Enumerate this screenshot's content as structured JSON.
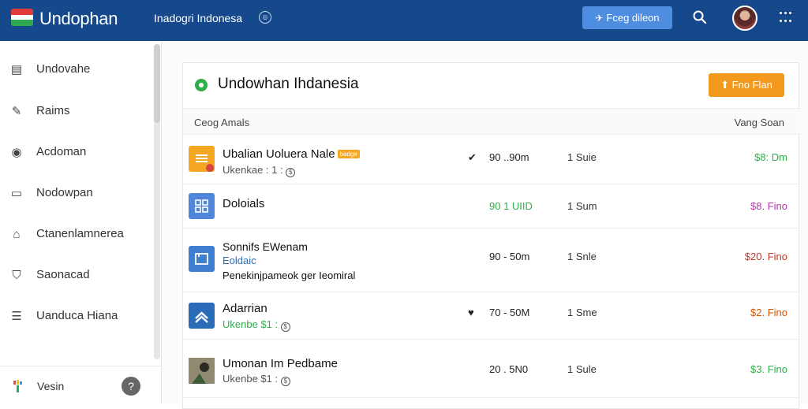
{
  "header": {
    "app_name": "Undophan",
    "region": "Inadogri Indonesa",
    "cta_label": "Fceg dileon",
    "icons": [
      "flag-icon",
      "globe-icon",
      "search-icon",
      "avatar",
      "apps-grid-icon"
    ]
  },
  "sidebar": {
    "items": [
      {
        "label": "Undovahe",
        "icon": "document-icon"
      },
      {
        "label": "Raims",
        "icon": "edit-icon"
      },
      {
        "label": "Acdoman",
        "icon": "target-icon"
      },
      {
        "label": "Nodowpan",
        "icon": "monitor-icon"
      },
      {
        "label": "Ctanenlamnerea",
        "icon": "building-icon"
      },
      {
        "label": "Saonacad",
        "icon": "shield-icon"
      },
      {
        "label": "Uanduca Hiana",
        "icon": "list-icon"
      }
    ],
    "footer": {
      "label": "Vesin",
      "help": "?"
    }
  },
  "card": {
    "title": "Undowhan Ihdanesia",
    "primary_button": "Fno Flan",
    "column_left": "Ceog Amals",
    "column_right": "Vang Soan"
  },
  "rows": [
    {
      "name": "Ubalian Uoluera Nale",
      "badge": "badge",
      "sub": "Ukenkae : 1 :",
      "mark": "✔",
      "span": "90 ..90m",
      "count": "1 Suie",
      "price": "$8: Dm",
      "price_color": "#2fae4a",
      "icon_color": "#f5a623",
      "span_color": "#222"
    },
    {
      "name": "Doloials",
      "sub": "",
      "mark": "",
      "span": "90 1 UIID",
      "count": "1 Sum",
      "price": "$8. Fino",
      "price_color": "#b13aa8",
      "icon_color": "#4f86d9",
      "span_color": "#2fae4a"
    },
    {
      "name": "Sonnifs EWenam",
      "sub": "Eoldaic",
      "extra": "Penekinjpameok ger Ieomiral",
      "mark": "",
      "span": "90 - 50m",
      "count": "1 Snle",
      "price": "$20. Fino",
      "price_color": "#c0392b",
      "icon_color": "#3f7fd0",
      "span_color": "#222"
    },
    {
      "name": "Adarrian",
      "sub": "Ukenbe $1 :",
      "mark": "♥",
      "span": "70 - 50M",
      "count": "1 Sme",
      "price": "$2. Fino",
      "price_color": "#d35400",
      "icon_color": "#2a6cb8",
      "span_color": "#222"
    },
    {
      "name": "Umonan Im Pedbame",
      "sub": "Ukenbe $1 :",
      "mark": "",
      "span": "20 . 5N0",
      "count": "1 Sule",
      "price": "$3. Fino",
      "price_color": "#2fae4a",
      "icon_color": "#7a6a4a",
      "span_color": "#222"
    }
  ]
}
